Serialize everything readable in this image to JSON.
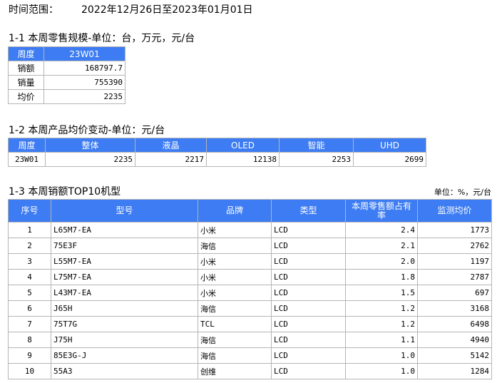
{
  "time_range": {
    "label": "时间范围：",
    "value": "2022年12月26日至2023年01月01日"
  },
  "section1": {
    "title": "1-1 本周零售规模-单位：台，万元，元/台",
    "header_label": "周度",
    "header_value": "23W01",
    "rows": [
      {
        "label": "销额",
        "value": "168797.7"
      },
      {
        "label": "销量",
        "value": "755390"
      },
      {
        "label": "均价",
        "value": "2235"
      }
    ]
  },
  "section2": {
    "title": "1-2 本周产品均价变动-单位：元/台",
    "headers": [
      "周度",
      "整体",
      "液晶",
      "OLED",
      "智能",
      "UHD"
    ],
    "row": [
      "23W01",
      "2235",
      "2217",
      "12138",
      "2253",
      "2699"
    ]
  },
  "section3": {
    "title": "1-3 本周销额TOP10机型",
    "unit_note": "单位：%，元/台",
    "headers": [
      "序号",
      "型号",
      "品牌",
      "类型",
      "本周零售额占有率",
      "监测均价"
    ],
    "rows": [
      [
        "1",
        "L65M7-EA",
        "小米",
        "LCD",
        "2.4",
        "1773"
      ],
      [
        "2",
        "75E3F",
        "海信",
        "LCD",
        "2.1",
        "2762"
      ],
      [
        "3",
        "L55M7-EA",
        "小米",
        "LCD",
        "2.0",
        "1197"
      ],
      [
        "4",
        "L75M7-EA",
        "小米",
        "LCD",
        "1.8",
        "2787"
      ],
      [
        "5",
        "L43M7-EA",
        "小米",
        "LCD",
        "1.5",
        "697"
      ],
      [
        "6",
        "J65H",
        "海信",
        "LCD",
        "1.2",
        "3168"
      ],
      [
        "7",
        "75T7G",
        "TCL",
        "LCD",
        "1.2",
        "6498"
      ],
      [
        "8",
        "J75H",
        "海信",
        "LCD",
        "1.1",
        "4940"
      ],
      [
        "9",
        "85E3G-J",
        "海信",
        "LCD",
        "1.0",
        "5142"
      ],
      [
        "10",
        "55A3",
        "创维",
        "LCD",
        "1.0",
        "1284"
      ]
    ]
  }
}
